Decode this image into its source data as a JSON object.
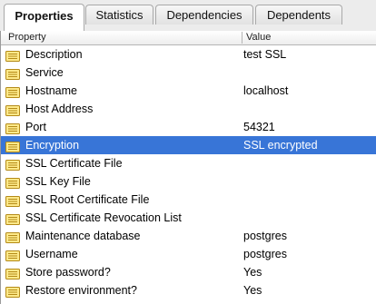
{
  "tabs": [
    {
      "label": "Properties",
      "active": true
    },
    {
      "label": "Statistics",
      "active": false
    },
    {
      "label": "Dependencies",
      "active": false
    },
    {
      "label": "Dependents",
      "active": false
    }
  ],
  "columns": {
    "property": "Property",
    "value": "Value"
  },
  "rows": [
    {
      "name": "Description",
      "value": "test SSL"
    },
    {
      "name": "Service",
      "value": ""
    },
    {
      "name": "Hostname",
      "value": "localhost"
    },
    {
      "name": "Host Address",
      "value": ""
    },
    {
      "name": "Port",
      "value": "54321"
    },
    {
      "name": "Encryption",
      "value": "SSL encrypted",
      "selected": true
    },
    {
      "name": "SSL Certificate File",
      "value": ""
    },
    {
      "name": "SSL Key File",
      "value": ""
    },
    {
      "name": "SSL Root Certificate File",
      "value": ""
    },
    {
      "name": "SSL Certificate Revocation List",
      "value": ""
    },
    {
      "name": "Maintenance database",
      "value": "postgres"
    },
    {
      "name": "Username",
      "value": "postgres"
    },
    {
      "name": "Store password?",
      "value": "Yes"
    },
    {
      "name": "Restore environment?",
      "value": "Yes"
    }
  ],
  "colors": {
    "selection": "#3875d7",
    "icon_fill": "#fde98a",
    "icon_stroke": "#b48a17"
  },
  "row_icon": "property-list-icon"
}
